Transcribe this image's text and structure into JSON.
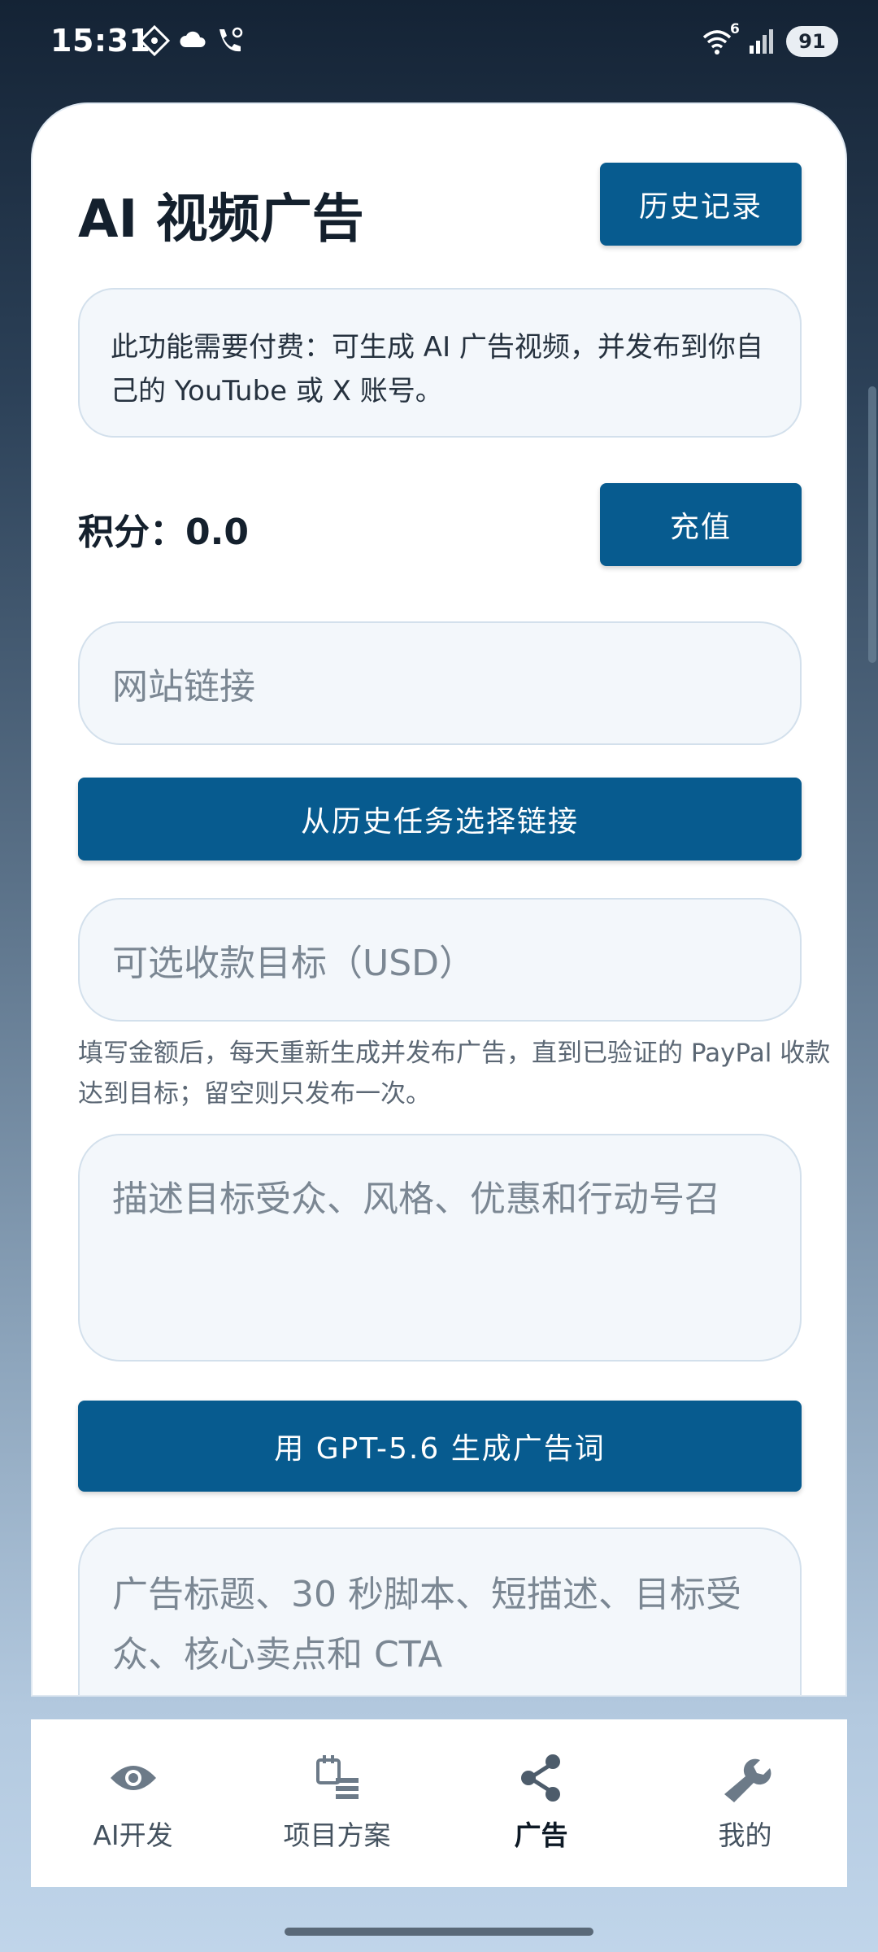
{
  "status_bar": {
    "time": "15:31",
    "battery": "91",
    "wifi_badge": "6",
    "icons": [
      "location-diamond-icon",
      "cloud-icon",
      "wifi-calling-icon",
      "wifi-icon",
      "signal-icon",
      "battery-icon"
    ]
  },
  "header": {
    "title": "AI 视频广告",
    "history_button": "历史记录"
  },
  "notice": {
    "text": "此功能需要付费：可生成 AI 广告视频，并发布到你自己的 YouTube 或 X 账号。"
  },
  "points": {
    "label": "积分：0.0",
    "recharge_button": "充值"
  },
  "form": {
    "url_placeholder": "网站链接",
    "select_history_button": "从历史任务选择链接",
    "usd_placeholder": "可选收款目标（USD）",
    "usd_hint": "填写金额后，每天重新生成并发布广告，直到已验证的 PayPal 收款达到目标；留空则只发布一次。",
    "description_placeholder": "描述目标受众、风格、优惠和行动号召",
    "generate_button": "用 GPT-5.6 生成广告词",
    "output_placeholder": "广告标题、30 秒脚本、短描述、目标受众、核心卖点和 CTA"
  },
  "bottom_nav": {
    "items": [
      {
        "label": "AI开发",
        "icon": "eye-icon",
        "active": false
      },
      {
        "label": "项目方案",
        "icon": "project-plan-icon",
        "active": false
      },
      {
        "label": "广告",
        "icon": "share-icon",
        "active": true
      },
      {
        "label": "我的",
        "icon": "wrench-icon",
        "active": false
      }
    ]
  },
  "colors": {
    "primary": "#075b8f",
    "field_bg": "#f3f7fb",
    "field_border": "#d3e0ec",
    "title_text": "#14202d"
  }
}
